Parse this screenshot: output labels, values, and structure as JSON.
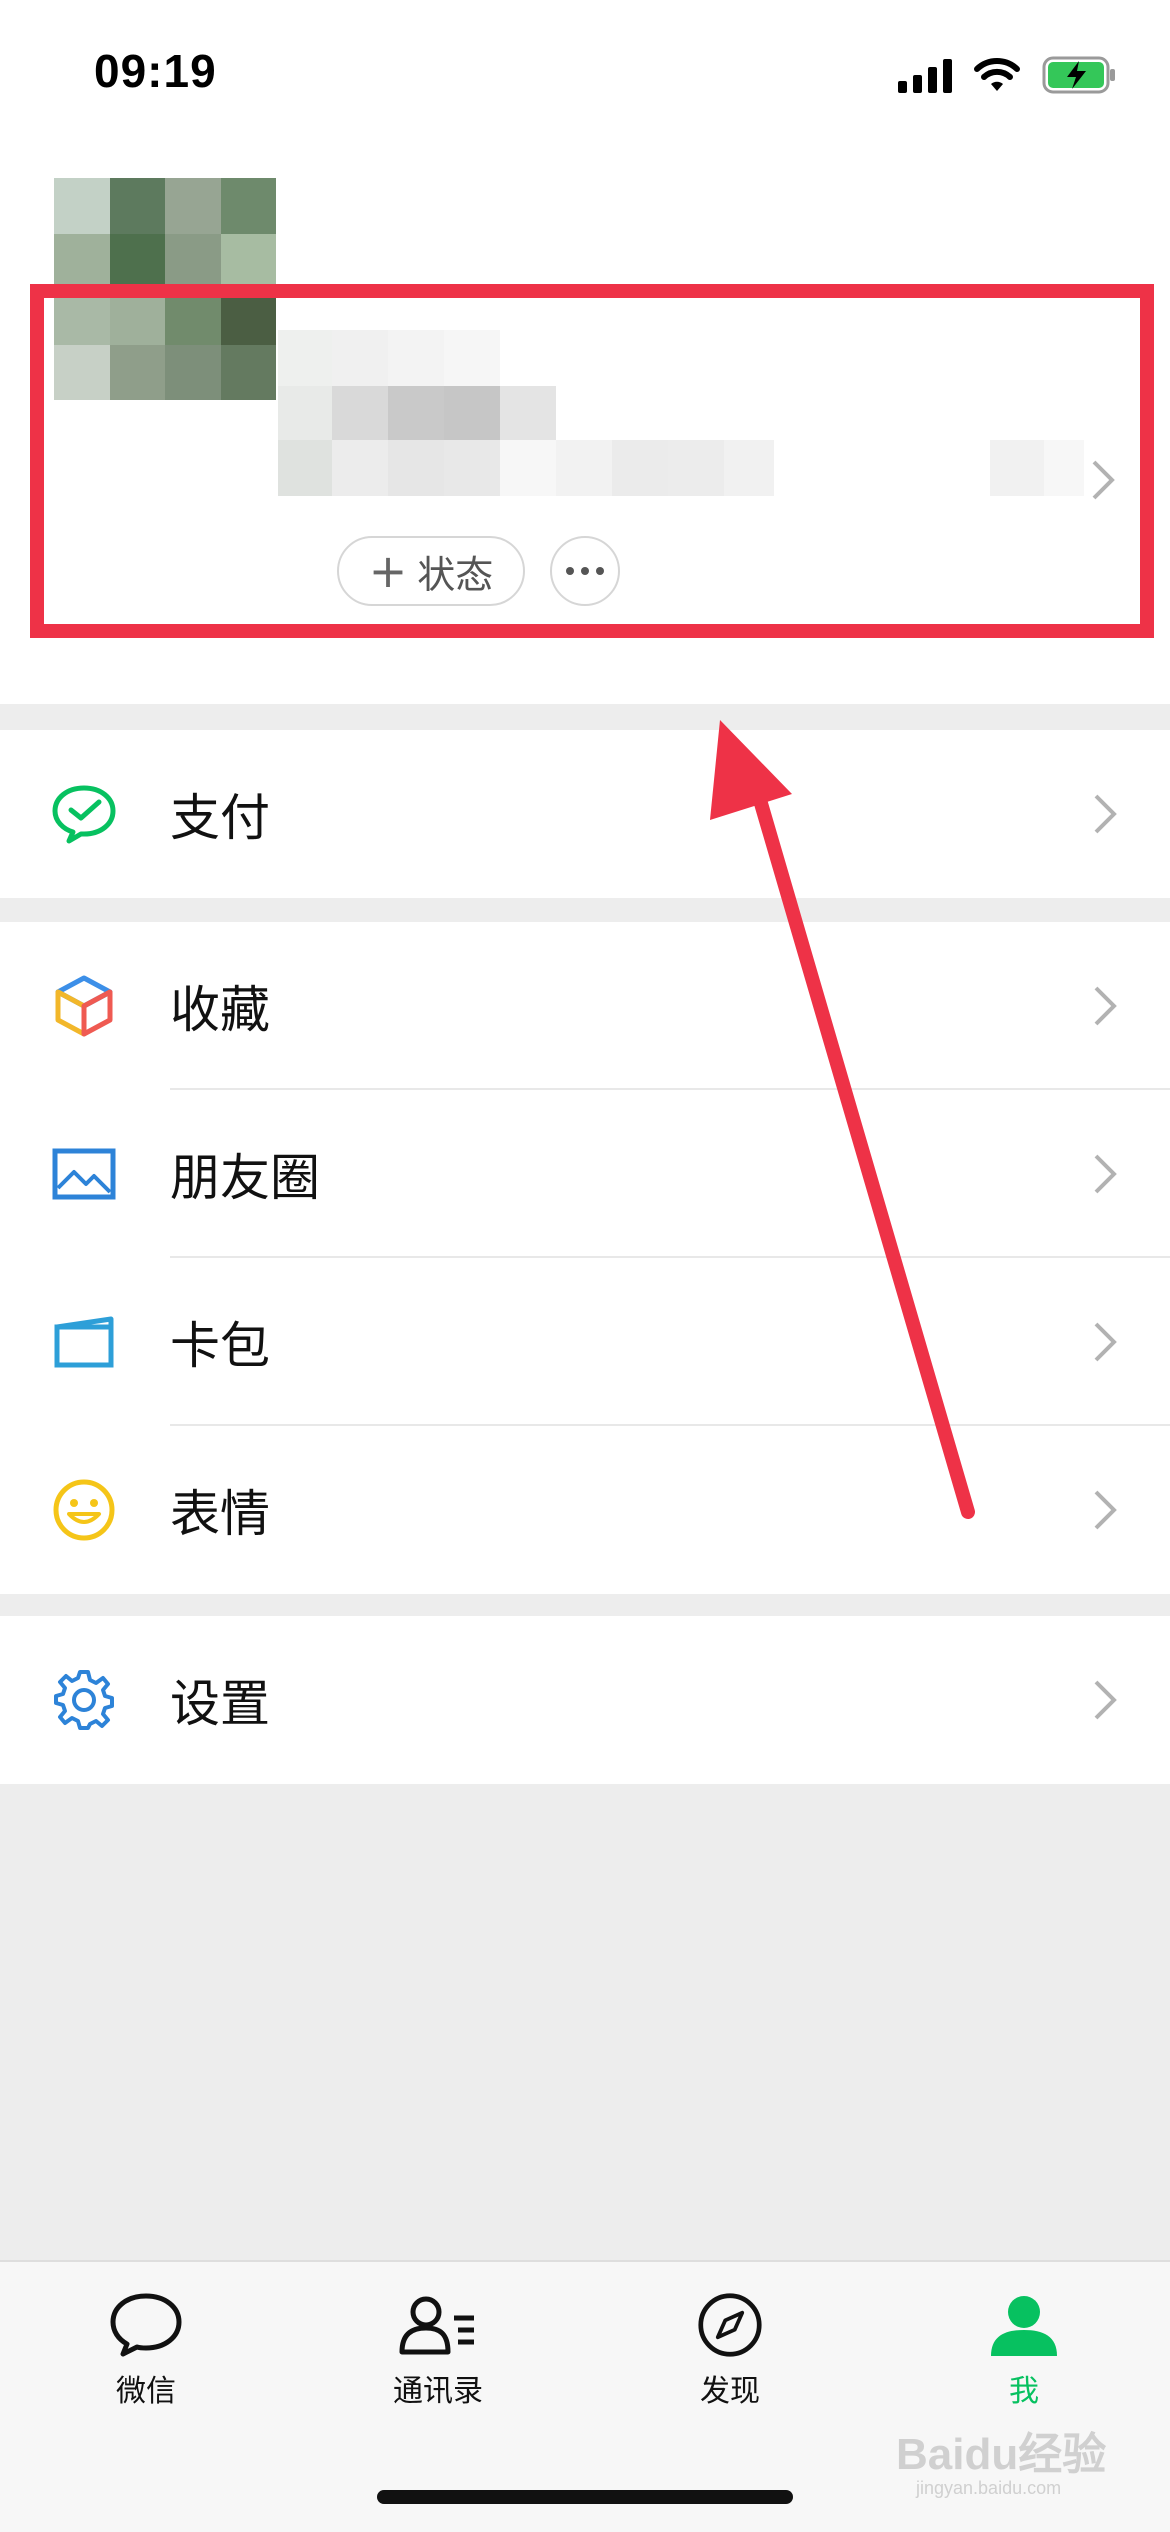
{
  "status_bar": {
    "time": "09:19"
  },
  "profile": {
    "status_button_label": "状态",
    "status_button_prefix": "+"
  },
  "menu": {
    "pay": {
      "label": "支付"
    },
    "favorites": {
      "label": "收藏"
    },
    "moments": {
      "label": "朋友圈"
    },
    "cards": {
      "label": "卡包"
    },
    "stickers": {
      "label": "表情"
    },
    "settings": {
      "label": "设置"
    }
  },
  "tabs": [
    {
      "label": "微信",
      "icon": "chat-bubble-icon",
      "active": false
    },
    {
      "label": "通讯录",
      "icon": "contacts-icon",
      "active": false
    },
    {
      "label": "发现",
      "icon": "compass-icon",
      "active": false
    },
    {
      "label": "我",
      "icon": "person-icon",
      "active": true
    }
  ],
  "watermark": {
    "text": "Baidu经验",
    "sub": "jingyan.baidu.com"
  },
  "colors": {
    "accent_green": "#07c160",
    "highlight_red": "#ee3247",
    "background": "#ededed"
  }
}
